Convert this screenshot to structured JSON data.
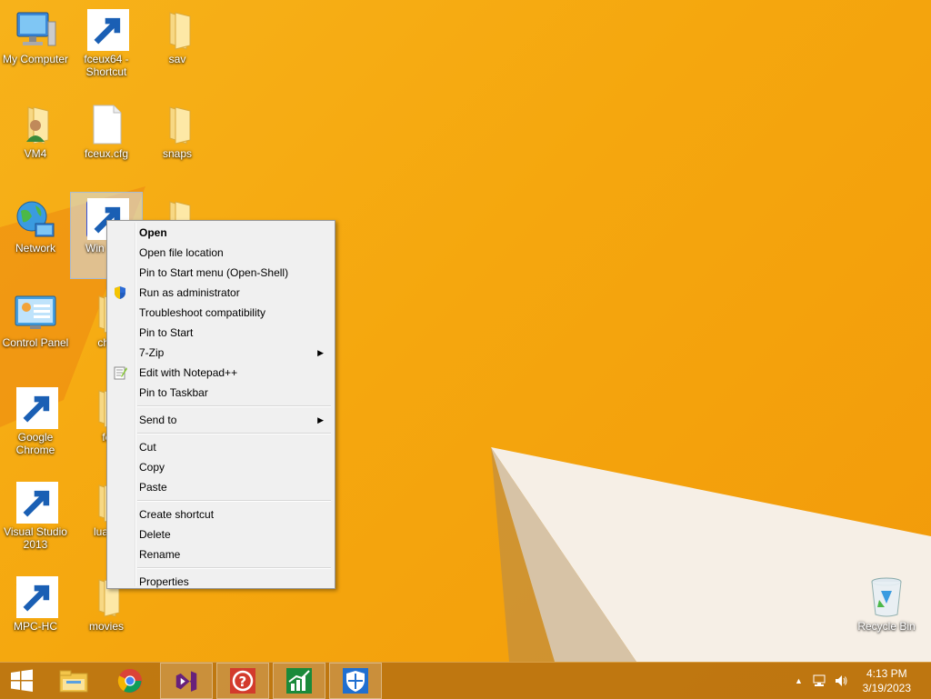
{
  "desktop": {
    "icons": [
      {
        "label": "My Computer"
      },
      {
        "label": "fceux64 - Shortcut"
      },
      {
        "label": "sav"
      },
      {
        "label": "VM4"
      },
      {
        "label": "fceux.cfg"
      },
      {
        "label": "snaps"
      },
      {
        "label": "Network"
      },
      {
        "label": "Win"
      },
      {
        "label": ""
      },
      {
        "label": "Control Panel"
      },
      {
        "label": "che"
      },
      {
        "label": "Google Chrome"
      },
      {
        "label": "fc"
      },
      {
        "label": "Visual Studio 2013"
      },
      {
        "label": "luasc"
      },
      {
        "label": "MPC-HC"
      },
      {
        "label": "movies"
      },
      {
        "label": "Recycle Bin"
      }
    ]
  },
  "context_menu": {
    "items": [
      {
        "label": "Open"
      },
      {
        "label": "Open file location"
      },
      {
        "label": "Pin to Start menu (Open-Shell)"
      },
      {
        "label": "Run as administrator"
      },
      {
        "label": "Troubleshoot compatibility"
      },
      {
        "label": "Pin to Start"
      },
      {
        "label": "7-Zip"
      },
      {
        "label": "Edit with Notepad++"
      },
      {
        "label": "Pin to Taskbar"
      },
      {
        "label": "Send to"
      },
      {
        "label": "Cut"
      },
      {
        "label": "Copy"
      },
      {
        "label": "Paste"
      },
      {
        "label": "Create shortcut"
      },
      {
        "label": "Delete"
      },
      {
        "label": "Rename"
      },
      {
        "label": "Properties"
      }
    ]
  },
  "taskbar": {
    "time": "4:13 PM",
    "date": "3/19/2023"
  },
  "colors": {
    "wallpaper": "#f5a70e",
    "taskbar": "#b57012",
    "menu_bg": "#f0f0f0"
  }
}
